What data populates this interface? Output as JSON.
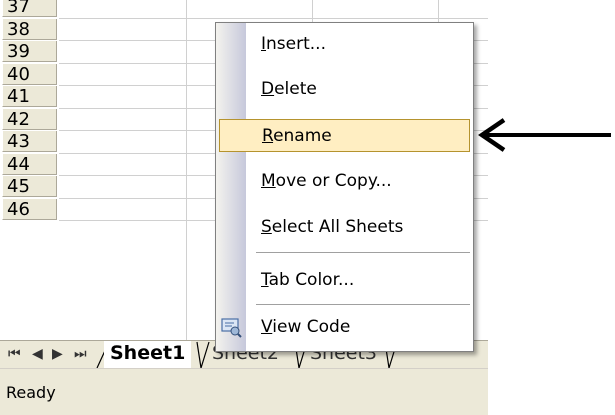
{
  "rows": [
    "37",
    "38",
    "39",
    "40",
    "41",
    "42",
    "43",
    "44",
    "45",
    "46"
  ],
  "menu": {
    "items": [
      {
        "pre": "",
        "key": "I",
        "post": "nsert..."
      },
      {
        "pre": "",
        "key": "D",
        "post": "elete"
      },
      {
        "pre": "",
        "key": "R",
        "post": "ename"
      },
      {
        "pre": "",
        "key": "M",
        "post": "ove or Copy..."
      },
      {
        "pre": "",
        "key": "S",
        "post": "elect All Sheets"
      },
      {
        "pre": "",
        "key": "T",
        "post": "ab Color..."
      },
      {
        "pre": "",
        "key": "V",
        "post": "iew Code"
      }
    ]
  },
  "tabs": [
    {
      "label": "Sheet1",
      "active": true
    },
    {
      "label": "Sheet2",
      "active": false
    },
    {
      "label": "Sheet3",
      "active": false
    }
  ],
  "nav": {
    "first": "⏮",
    "prev": "◀",
    "next": "▶",
    "last": "⏭"
  },
  "status": {
    "text": "Ready"
  },
  "colors": {
    "highlight": "#ffeec2",
    "highlight_border": "#b5932e",
    "chrome": "#ece9d8"
  },
  "icons": {
    "view_code": "view-code-icon",
    "annotation": "arrow-left-icon"
  }
}
